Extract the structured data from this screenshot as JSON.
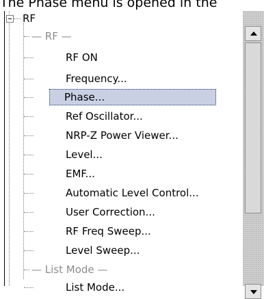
{
  "caption": "The Phase menu is opened in the",
  "tree": {
    "root_label": "RF",
    "items": [
      {
        "label": "— RF —",
        "kind": "separator",
        "selected": false
      },
      {
        "label": "RF ON",
        "kind": "item",
        "selected": false
      },
      {
        "label": "Frequency...",
        "kind": "item",
        "selected": false
      },
      {
        "label": "Phase...",
        "kind": "item",
        "selected": true
      },
      {
        "label": "Ref Oscillator...",
        "kind": "item",
        "selected": false
      },
      {
        "label": "NRP-Z Power Viewer...",
        "kind": "item",
        "selected": false
      },
      {
        "label": "Level...",
        "kind": "item",
        "selected": false
      },
      {
        "label": "EMF...",
        "kind": "item",
        "selected": false
      },
      {
        "label": "Automatic Level Control...",
        "kind": "item",
        "selected": false
      },
      {
        "label": "User Correction...",
        "kind": "item",
        "selected": false
      },
      {
        "label": "RF Freq Sweep...",
        "kind": "item",
        "selected": false
      },
      {
        "label": "Level Sweep...",
        "kind": "item",
        "selected": false
      },
      {
        "label": "— List Mode —",
        "kind": "separator",
        "selected": false
      },
      {
        "label": "List Mode...",
        "kind": "item",
        "selected": false
      }
    ]
  }
}
